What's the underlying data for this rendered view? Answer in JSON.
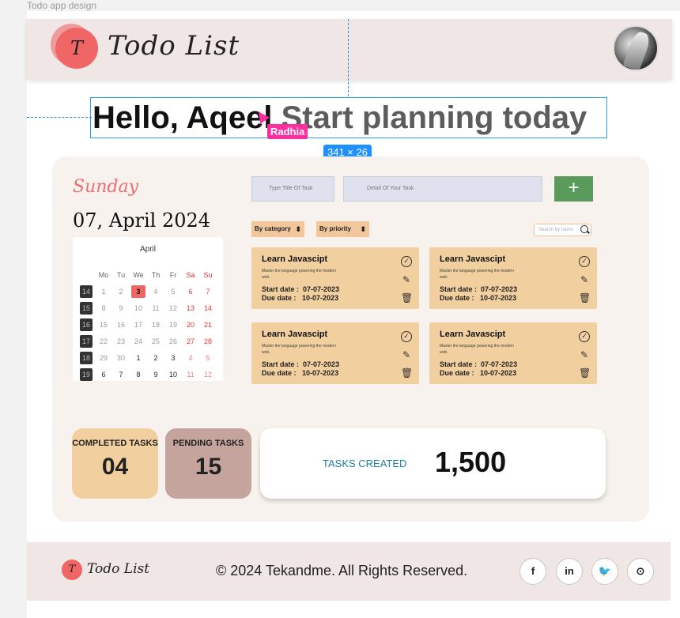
{
  "frame_label": "Todo app design",
  "header": {
    "logo_letter": "T",
    "logo_text": "Todo List"
  },
  "hero": {
    "greeting": "Hello, Aqeel",
    "subtitle": "Start planning today"
  },
  "editor": {
    "collaborator": "Radhia",
    "dimensions": "341 × 26"
  },
  "day_name": "Sunday",
  "date_text": "07, April 2024",
  "calendar": {
    "month": "April",
    "headers": [
      "Mo",
      "Tu",
      "We",
      "Th",
      "Fr",
      "Sa",
      "Su"
    ],
    "weeks": [
      {
        "n": "14",
        "d": [
          "1",
          "2",
          "3",
          "4",
          "5",
          "6",
          "7"
        ]
      },
      {
        "n": "15",
        "d": [
          "8",
          "9",
          "10",
          "11",
          "12",
          "13",
          "14"
        ]
      },
      {
        "n": "16",
        "d": [
          "15",
          "16",
          "17",
          "18",
          "19",
          "20",
          "21"
        ]
      },
      {
        "n": "17",
        "d": [
          "22",
          "23",
          "24",
          "25",
          "26",
          "27",
          "28"
        ]
      },
      {
        "n": "18",
        "d": [
          "29",
          "30",
          "1",
          "2",
          "3",
          "4",
          "5"
        ]
      },
      {
        "n": "19",
        "d": [
          "6",
          "7",
          "8",
          "9",
          "10",
          "11",
          "12"
        ]
      }
    ],
    "today": "3"
  },
  "form": {
    "title_placeholder": "Type Title Of Task",
    "detail_placeholder": "Detail Of Your Task",
    "add_label": "+"
  },
  "filters": {
    "category": "By category",
    "priority": "By priority",
    "search_placeholder": "Search by name"
  },
  "tasks": [
    {
      "title": "Learn Javascipt",
      "desc": "Master the language powering the modern web.",
      "start_label": "Start date :",
      "start": "07-07-2023",
      "due_label": "Due date :",
      "due": "10-07-2023"
    },
    {
      "title": "Learn Javascipt",
      "desc": "Master the language powering the modern web.",
      "start_label": "Start date :",
      "start": "07-07-2023",
      "due_label": "Due date :",
      "due": "10-07-2023"
    },
    {
      "title": "Learn Javascipt",
      "desc": "Master the language powering the modern web.",
      "start_label": "Start date :",
      "start": "07-07-2023",
      "due_label": "Due date :",
      "due": "10-07-2023"
    },
    {
      "title": "Learn Javascipt",
      "desc": "Master the language powering the modern web.",
      "start_label": "Start date :",
      "start": "07-07-2023",
      "due_label": "Due date :",
      "due": "10-07-2023"
    }
  ],
  "stats": {
    "completed_label": "COMPLETED TASKS",
    "completed": "04",
    "pending_label": "PENDING TASKS",
    "pending": "15",
    "created_label": "TASKS CREATED",
    "created": "1,500"
  },
  "colors": {
    "accent": "#f06565",
    "completed_bg": "#f2cf9e",
    "pending_bg": "#c4a49c",
    "add_button": "#5a9a5a"
  },
  "footer": {
    "logo_letter": "T",
    "logo_text": "Todo List",
    "copyright": "© 2024 Tekandme. All Rights Reserved.",
    "social": [
      {
        "icon": "facebook-icon",
        "glyph": "f"
      },
      {
        "icon": "linkedin-icon",
        "glyph": "in"
      },
      {
        "icon": "twitter-icon",
        "glyph": "🐦"
      },
      {
        "icon": "github-icon",
        "glyph": "⊙"
      }
    ]
  }
}
